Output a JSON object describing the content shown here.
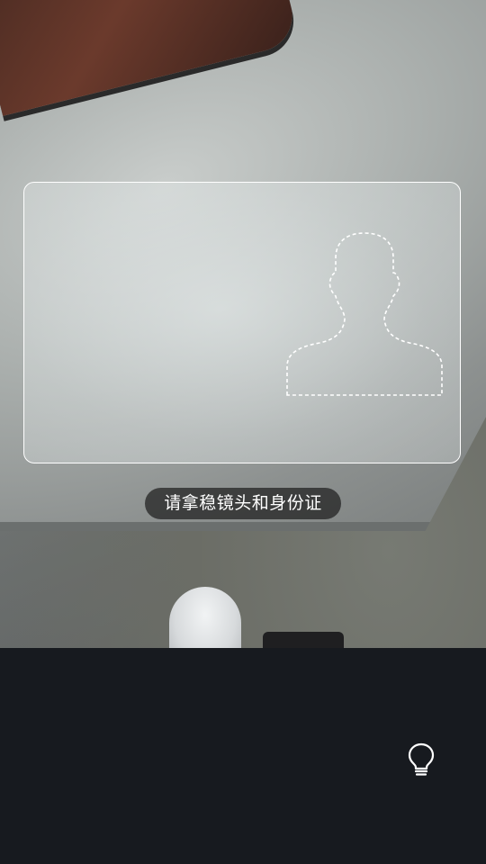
{
  "scan": {
    "hint_text": "请拿稳镜头和身份证"
  },
  "icons": {
    "flash": "lightbulb-icon",
    "portrait_guide": "person-silhouette-icon"
  },
  "colors": {
    "control_bar": "#171a1f",
    "frame_border": "#ffffff",
    "hint_background": "#1e1e1e"
  }
}
